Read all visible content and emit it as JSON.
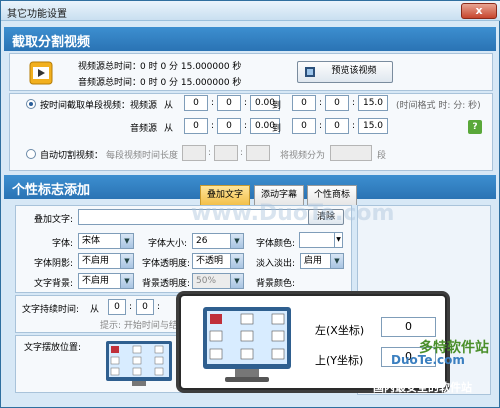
{
  "window": {
    "title": "其它功能设置",
    "close_glyph": "x"
  },
  "section_cut": {
    "title": "截取分割视频",
    "video_total_label": "视频源总时间：",
    "video_total_value": "0   时 0   分 15.000000 秒",
    "audio_total_label": "音频源总时间：",
    "audio_total_value": "0   时 0   分 15.000000 秒",
    "preview_button": "预览该视频",
    "mode_segment_label": "按时间截取单段视频：",
    "video_src_label": "视频源",
    "audio_src_label": "音频源",
    "from": "从",
    "to": "到",
    "zero": "0",
    "zero_dec": "0.00",
    "end_sec": "15.0",
    "time_format": "(时间格式 时: 分: 秒)",
    "help_glyph": "?",
    "mode_auto_label": "自动切割视频：",
    "per_segment_label": "每段视频时间长度",
    "split_label": "将视频分为",
    "segments": "段"
  },
  "section_logo": {
    "title": "个性标志添加",
    "tabs": [
      "叠加文字",
      "添动字幕",
      "个性商标"
    ],
    "add_text_label": "叠加文字:",
    "clear_button": "清除",
    "font_label": "字体:",
    "font_value": "宋体",
    "size_label": "字体大小:",
    "size_value": "26",
    "color_label": "字体颜色:",
    "shadow_label": "字体阴影:",
    "shadow_value": "不启用",
    "opacity_label": "字体透明度:",
    "opacity_value": "不透明",
    "fade_label": "淡入淡出:",
    "fade_value": "启用",
    "bg_label": "文字背景:",
    "bg_value": "不启用",
    "bg_opacity_label": "背景透明度:",
    "bg_opacity_value": "50%",
    "bg_color_label": "背景颜色:",
    "duration_label": "文字持续时间:",
    "duration_from": "从",
    "hint": "提示: 开始时间与结束时",
    "position_label": "文字摆放位置:"
  },
  "popup": {
    "x_label": "左(X坐标)",
    "x_value": "0",
    "y_label": "上(Y坐标)",
    "y_value": "0"
  },
  "watermark": {
    "a": "www.DuoTe.com",
    "b": "多特软件站",
    "c": "DuoTe.com",
    "d": "国内最安全的软件站"
  },
  "colors": {
    "accent": "#2a73b4",
    "active_tab": "#f3c04b"
  }
}
